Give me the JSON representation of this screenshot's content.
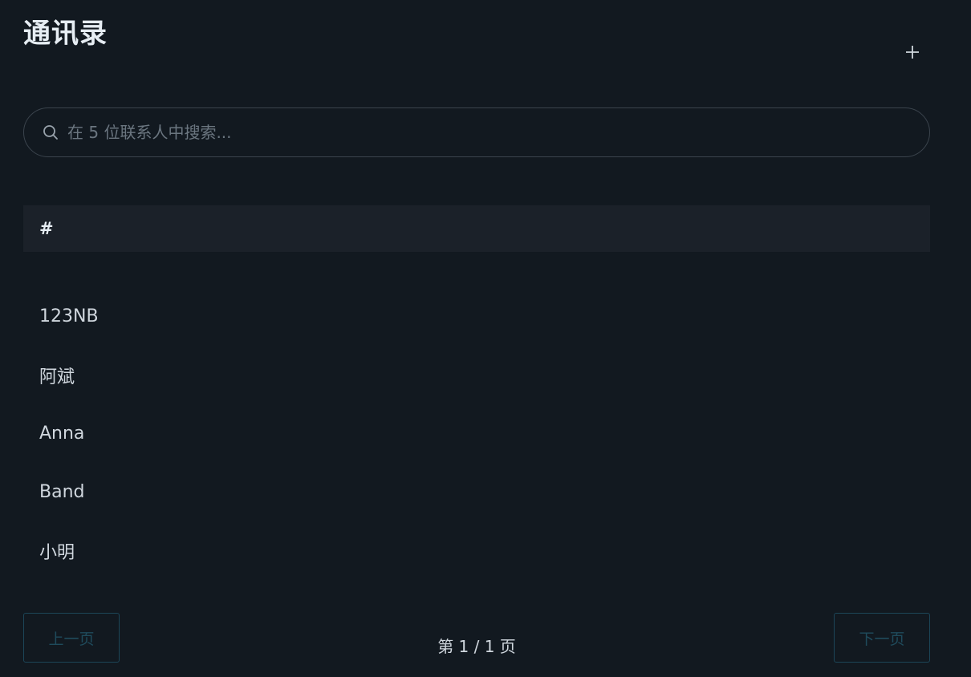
{
  "header": {
    "title": "通讯录",
    "add_icon": "plus-icon"
  },
  "search": {
    "placeholder": "在 5 位联系人中搜索...",
    "value": "",
    "icon": "search-icon"
  },
  "section": {
    "label": "#"
  },
  "contacts": [
    "123NB",
    "阿斌",
    "Anna",
    "Band",
    "小明"
  ],
  "pagination": {
    "prev_label": "上一页",
    "next_label": "下一页",
    "indicator": "第 1 / 1 页"
  },
  "colors": {
    "background": "#121920",
    "section_bg": "#1b2129",
    "disabled_button": "#1f4b5c"
  }
}
